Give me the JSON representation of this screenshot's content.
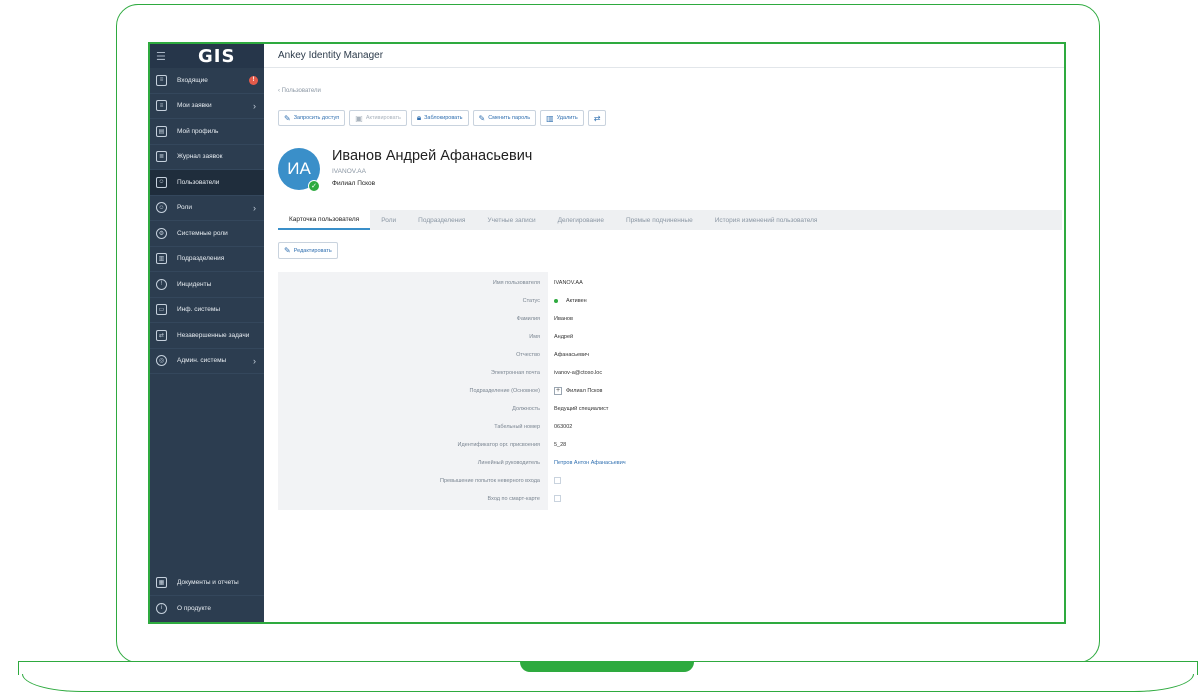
{
  "sidebar": {
    "logo": "GIS",
    "items": [
      {
        "label": "Входящие",
        "badge": "!"
      },
      {
        "label": "Мои заявки"
      },
      {
        "label": "Мой профиль"
      },
      {
        "label": "Журнал заявок"
      },
      {
        "label": "Пользователи"
      },
      {
        "label": "Роли"
      },
      {
        "label": "Системные роли"
      },
      {
        "label": "Подразделения"
      },
      {
        "label": "Инциденты"
      },
      {
        "label": "Инф. системы"
      },
      {
        "label": "Незавершенные задачи"
      },
      {
        "label": "Админ. системы"
      }
    ],
    "bottom": [
      {
        "label": "Документы и отчеты"
      },
      {
        "label": "О продукте"
      }
    ]
  },
  "header": {
    "title": "Ankey Identity Manager"
  },
  "breadcrumb": "Пользователи",
  "toolbar": {
    "request_access": "Запросить доступ",
    "activate": "Активировать",
    "block": "Заблокировать",
    "change_password": "Сменить пароль",
    "delete": "Удалить"
  },
  "user": {
    "initials": "ИА",
    "full_name": "Иванов Андрей Афанасьевич",
    "login": "IVANOV.AA",
    "branch": "Филиал Псков"
  },
  "tabs": [
    "Карточка пользователя",
    "Роли",
    "Подразделения",
    "Учетные записи",
    "Делегирование",
    "Прямые подчиненные",
    "История изменений пользователя"
  ],
  "edit_label": "Редактировать",
  "fields": [
    {
      "label": "Имя пользователя",
      "value": "IVANOV.AA"
    },
    {
      "label": "Статус",
      "value": "Активен"
    },
    {
      "label": "Фамилия",
      "value": "Иванов"
    },
    {
      "label": "Имя",
      "value": "Андрей"
    },
    {
      "label": "Отчество",
      "value": "Афанасьевич"
    },
    {
      "label": "Электронная почта",
      "value": "ivanov-a@ctoso.loc"
    },
    {
      "label": "Подразделение (Основное)",
      "value": "Филиал Псков"
    },
    {
      "label": "Должность",
      "value": "Ведущий специалист"
    },
    {
      "label": "Табельный номер",
      "value": "063002"
    },
    {
      "label": "Идентификатор орг. присвоения",
      "value": "5_28"
    },
    {
      "label": "Линейный руководитель",
      "value": "Петров Антон Афанасьевич"
    },
    {
      "label": "Превышение попыток неверного входа",
      "value": ""
    },
    {
      "label": "Вход по смарт-карте",
      "value": ""
    }
  ],
  "colors": {
    "frame": "#2eaa3f",
    "sidebar": "#2c3d50",
    "accent": "#3a8fc9",
    "status_active": "#2eaa3f"
  }
}
